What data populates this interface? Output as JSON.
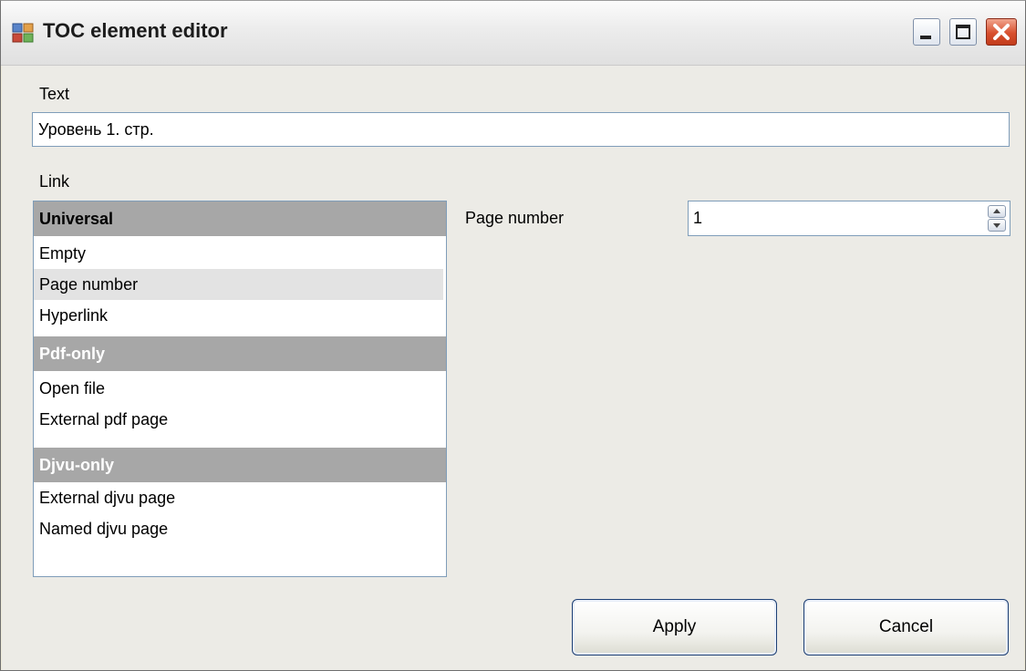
{
  "window": {
    "title": "TOC element editor"
  },
  "text_field": {
    "label": "Text",
    "value": "Уровень 1. стр."
  },
  "link": {
    "label": "Link",
    "groups": [
      {
        "header": "Universal",
        "items": [
          "Empty",
          "Page number",
          "Hyperlink"
        ]
      },
      {
        "header": "Pdf-only",
        "items": [
          "Open file",
          "External pdf page"
        ]
      },
      {
        "header": "Djvu-only",
        "items": [
          "External djvu page",
          "Named djvu page"
        ]
      }
    ],
    "selected": "Page number"
  },
  "page_number": {
    "label": "Page number",
    "value": "1"
  },
  "buttons": {
    "apply": "Apply",
    "cancel": "Cancel"
  }
}
